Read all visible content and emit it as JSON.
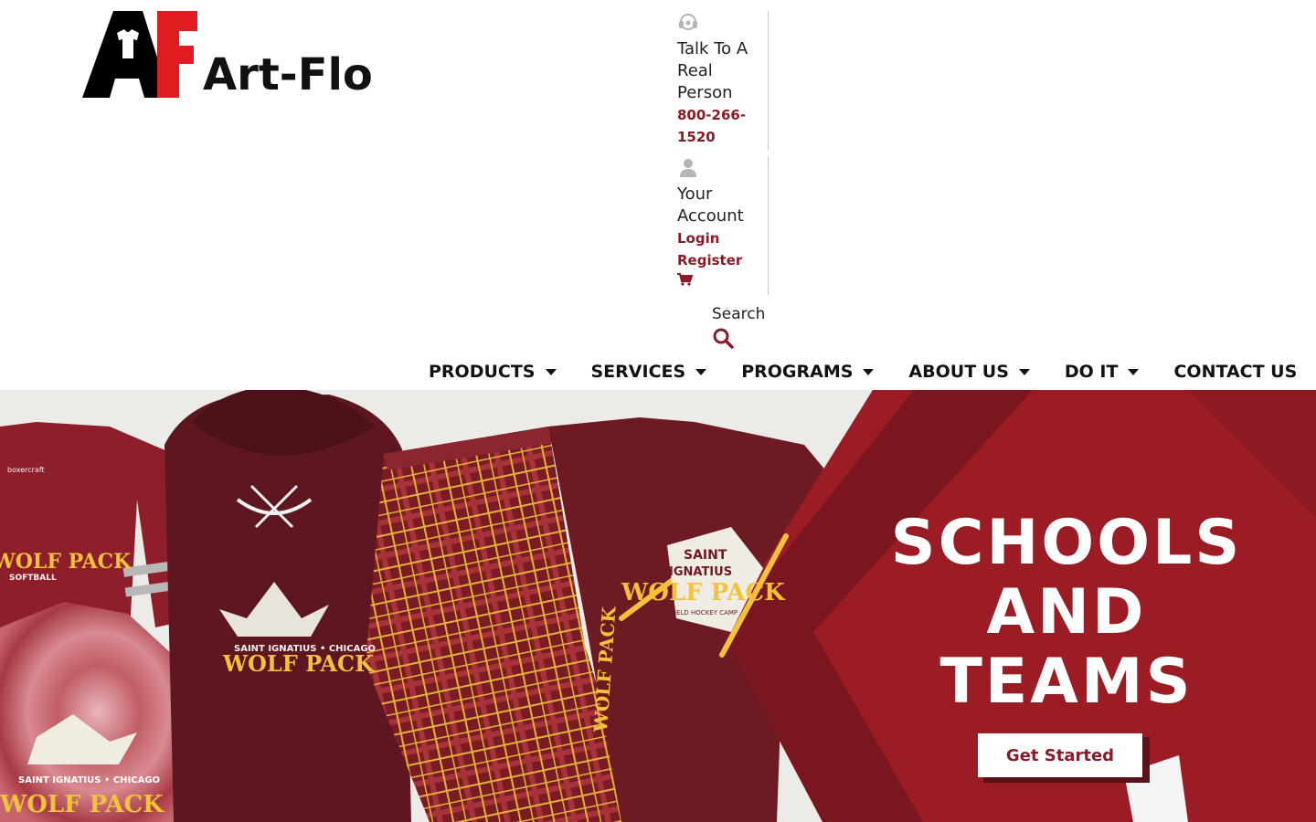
{
  "brand": {
    "logo_mark": "AF",
    "name": "Art-Flo",
    "logo_colors": [
      "#e11b22",
      "#000000"
    ]
  },
  "header": {
    "phone": {
      "icon": "headset-icon",
      "label": "Talk To A Real Person",
      "number": "800-266-1520"
    },
    "account": {
      "icon": "user-icon",
      "label": "Your Account",
      "login": "Login",
      "register": "Register"
    },
    "cart": {
      "icon": "cart-icon"
    },
    "search": {
      "label": "Search",
      "icon": "search-icon"
    }
  },
  "nav": [
    {
      "label": "PRODUCTS",
      "dropdown": true
    },
    {
      "label": "SERVICES",
      "dropdown": true
    },
    {
      "label": "PROGRAMS",
      "dropdown": true
    },
    {
      "label": "ABOUT US",
      "dropdown": true
    },
    {
      "label": "DO IT",
      "dropdown": true
    },
    {
      "label": "CONTACT US",
      "dropdown": false
    }
  ],
  "hero": {
    "title_lines": [
      "SCHOOLS",
      "AND",
      "TEAMS"
    ],
    "cta": "Get Started",
    "garment_text": {
      "wolf_pack": "WOLF PACK",
      "saint_ignatius_chicago": "SAINT IGNATIUS • CHICAGO",
      "saint": "SAINT",
      "ignatius": "IGNATIUS",
      "softball": "SOFTBALL",
      "field_hockey_camp": "FIELD HOCKEY CAMP",
      "brand_tag": "boxercraft"
    }
  },
  "colors": {
    "accent": "#8b1a2a",
    "hero_panel": "#9c1c26",
    "hero_dark": "#7a1620",
    "maroon_garment": "#6e1a22"
  }
}
